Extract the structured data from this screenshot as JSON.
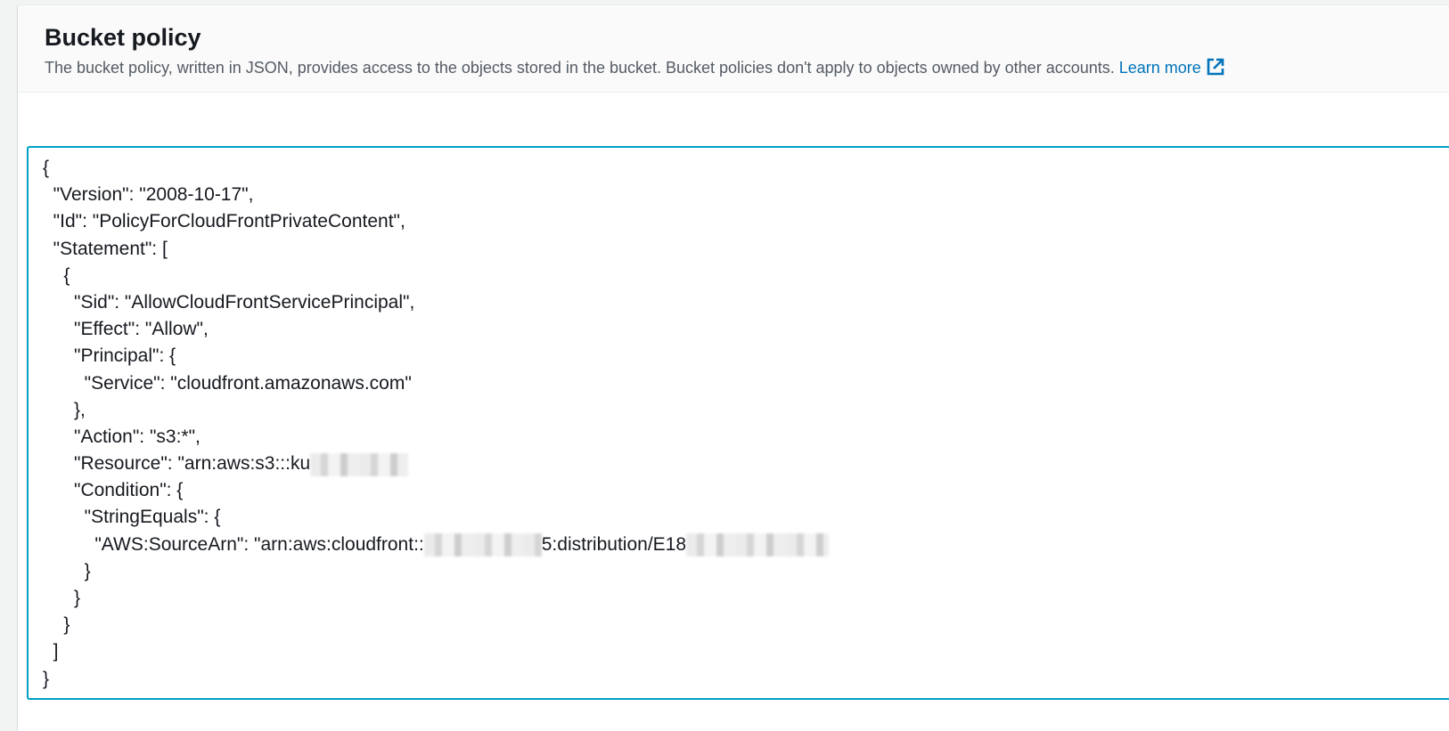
{
  "header": {
    "title": "Bucket policy",
    "description": "The bucket policy, written in JSON, provides access to the objects stored in the bucket. Bucket policies don't apply to objects owned by other accounts.",
    "learn_more_label": "Learn more",
    "learn_more_icon": "external-link-icon"
  },
  "editor": {
    "lines": [
      "{",
      "  \"Version\": \"2008-10-17\",",
      "  \"Id\": \"PolicyForCloudFrontPrivateContent\",",
      "  \"Statement\": [",
      "    {",
      "      \"Sid\": \"AllowCloudFrontServicePrincipal\",",
      "      \"Effect\": \"Allow\",",
      "      \"Principal\": {",
      "        \"Service\": \"cloudfront.amazonaws.com\"",
      "      },",
      "      \"Action\": \"s3:*\",",
      "      \"Resource\": \"arn:aws:s3:::ku",
      "      \"Condition\": {",
      "        \"StringEquals\": {",
      "          \"AWS:SourceArn\": \"arn:aws:cloudfront::",
      "        }",
      "      }",
      "    }",
      "  ]",
      "}"
    ],
    "source_arn_middle": "5:distribution/E18"
  },
  "colors": {
    "accent": "#0073bb",
    "editor_border": "#00a1c9",
    "text": "#16191f",
    "muted_text": "#545b64"
  }
}
